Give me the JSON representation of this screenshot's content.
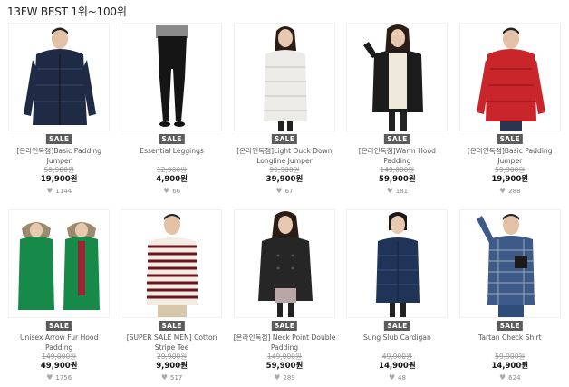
{
  "page": {
    "title": "13FW BEST 1위~100위"
  },
  "colors": {
    "sale_badge": "#5c5c5c",
    "price": "#111111",
    "original_price": "#999999"
  },
  "products": [
    {
      "sale": "SALE",
      "name": "[온라인독점]Basic Padding Jumper",
      "original_price": "59,900원",
      "price": "19,900원",
      "likes": "1144",
      "image": "navy padded jumper"
    },
    {
      "sale": "SALE",
      "name": "Essential Leggings",
      "original_price": "12,900원",
      "price": "4,900원",
      "likes": "66",
      "image": "black leggings"
    },
    {
      "sale": "SALE",
      "name": "[온라인독점]Light Duck Down Longline Jumper",
      "original_price": "99,900원",
      "price": "39,900원",
      "likes": "67",
      "image": "white long down jumper"
    },
    {
      "sale": "SALE",
      "name": "[온라인독점]Warm Hood Padding",
      "original_price": "149,000원",
      "price": "59,900원",
      "likes": "181",
      "image": "black hooded padding"
    },
    {
      "sale": "SALE",
      "name": "[온라인독점]Basic Padding Jumper",
      "original_price": "59,900원",
      "price": "19,900원",
      "likes": "288",
      "image": "red padded jumper"
    },
    {
      "sale": "SALE",
      "name": "Unisex Arrow Fur Hood Padding",
      "original_price": "149,000원",
      "price": "49,900원",
      "likes": "1756",
      "image": "green fur hood parkas"
    },
    {
      "sale": "SALE",
      "name": "[SUPER SALE MEN] Cotton Stripe Tee",
      "original_price": "29,900원",
      "price": "9,900원",
      "likes": "517",
      "image": "striped tee"
    },
    {
      "sale": "SALE",
      "name": "[온라인독점] Neck Point Double Padding",
      "original_price": "149,000원",
      "price": "59,900원",
      "likes": "289",
      "image": "black double padding"
    },
    {
      "sale": "SALE",
      "name": "Sung Slub Cardigan",
      "original_price": "49,900원",
      "price": "14,900원",
      "likes": "48",
      "image": "navy padded cardigan"
    },
    {
      "sale": "SALE",
      "name": "Tartan Check Shirt",
      "original_price": "59,900원",
      "price": "14,900원",
      "likes": "624",
      "image": "tartan check shirt"
    }
  ]
}
